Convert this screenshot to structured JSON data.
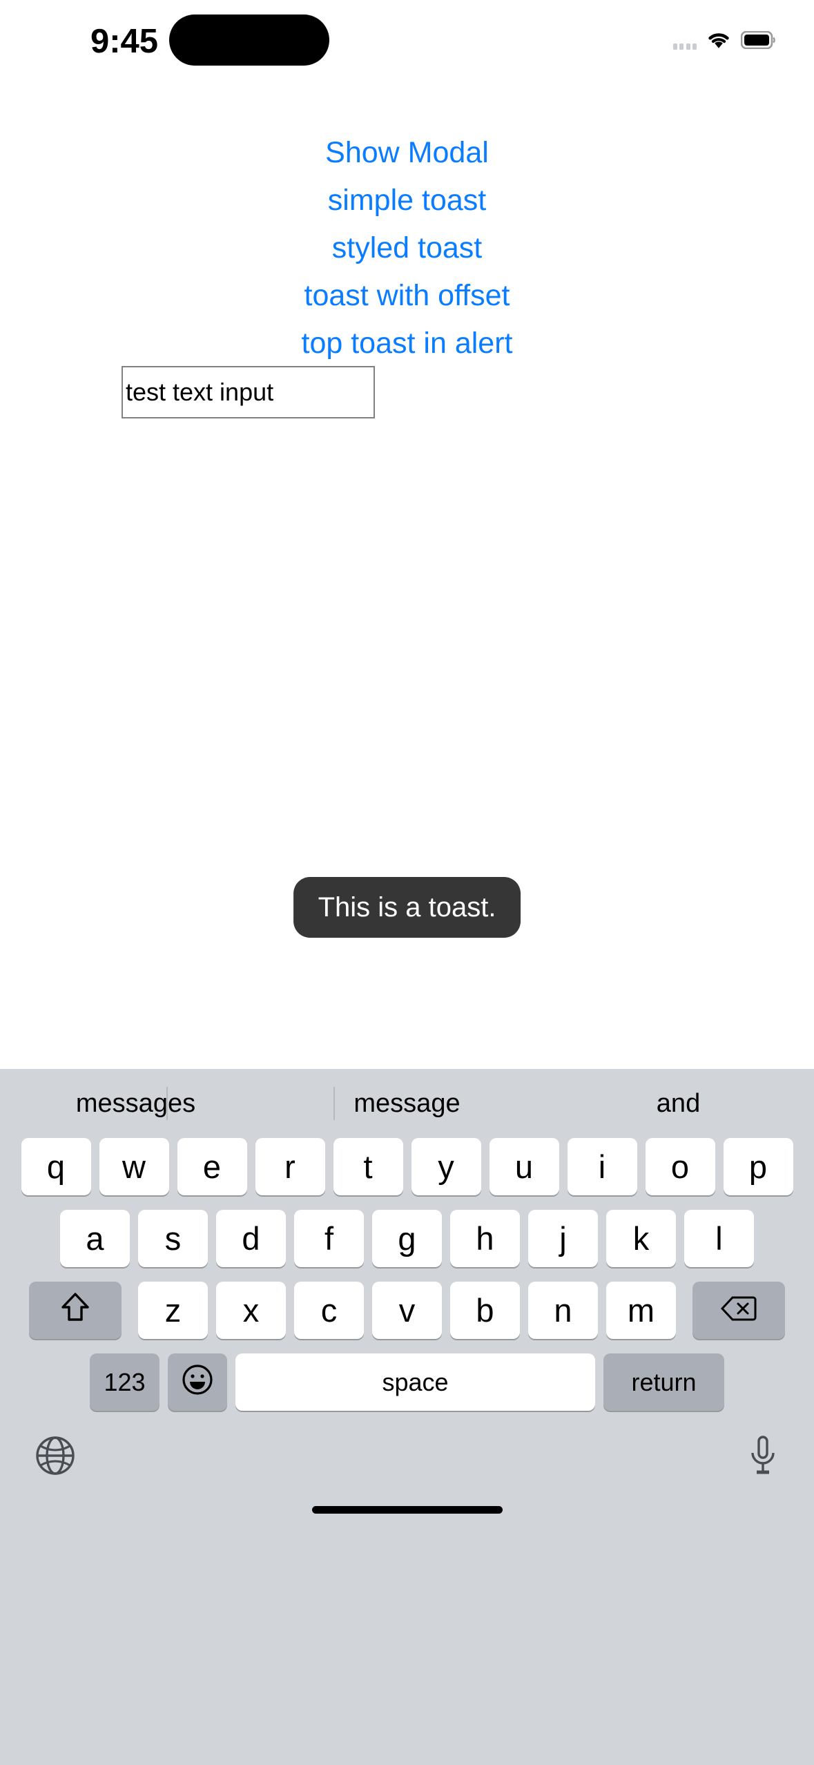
{
  "status_bar": {
    "time": "9:45",
    "icons": [
      "cellular-dots-icon",
      "wifi-icon",
      "battery-icon"
    ]
  },
  "main": {
    "buttons": [
      {
        "label": "Show Modal",
        "name": "show-modal-button"
      },
      {
        "label": "simple toast",
        "name": "simple-toast-button"
      },
      {
        "label": "styled toast",
        "name": "styled-toast-button"
      },
      {
        "label": "toast with offset",
        "name": "toast-with-offset-button"
      },
      {
        "label": "top toast in alert",
        "name": "top-toast-in-alert-button"
      }
    ],
    "text_input": {
      "value": "test text input",
      "placeholder": ""
    }
  },
  "toast": {
    "message": "This is a toast."
  },
  "keyboard": {
    "suggestions": [
      "messages",
      "message",
      "and"
    ],
    "row1": [
      "q",
      "w",
      "e",
      "r",
      "t",
      "y",
      "u",
      "i",
      "o",
      "p"
    ],
    "row2": [
      "a",
      "s",
      "d",
      "f",
      "g",
      "h",
      "j",
      "k",
      "l"
    ],
    "row3_letters": [
      "z",
      "x",
      "c",
      "v",
      "b",
      "n",
      "m"
    ],
    "shift_label": "",
    "backspace_label": "",
    "numeric_label": "123",
    "emoji_label": "",
    "space_label": "space",
    "return_label": "return"
  },
  "colors": {
    "accent_blue": "#0a7cff",
    "toast_bg": "#363636",
    "keyboard_bg": "#d1d4d9",
    "key_bg": "#ffffff",
    "mod_key_bg": "#a9aeb7"
  }
}
